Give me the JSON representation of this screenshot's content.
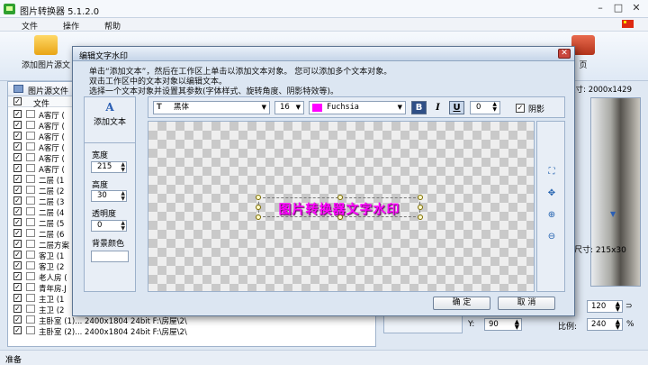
{
  "app": {
    "title": "图片转换器 5.1.2.0",
    "menu": [
      "文件",
      "操作",
      "帮助"
    ],
    "toolbar": {
      "add_image_source": "添加图片源文",
      "page": "页"
    },
    "source_panel_title": "图片源文件",
    "column_file": "文件",
    "files": [
      "A客厅 (",
      "A客厅 (",
      "A客厅 (",
      "A客厅 (",
      "A客厅 (",
      "A客厅 (",
      "二层 (1",
      "二层 (2",
      "二层 (3",
      "二层 (4",
      "二层 (5",
      "二层 (6",
      "二层方案",
      "客卫 (1",
      "客卫 (2",
      "老人房 (",
      "青年房.J",
      "主卫 (1",
      "主卫 (2",
      "主卧室 (1)...    2400x1804  24bit  F:\\房屋\\2\\",
      "主卧室 (2)...    2400x1804  24bit  F:\\房屋\\2\\"
    ],
    "image_size": "尺寸: 2000x1429",
    "watermark_size": "尺寸: 215x30",
    "value_120": "120",
    "y_label": "Y:",
    "y_value": "90",
    "scale_label": "比例:",
    "scale_value": "240",
    "percent": "%",
    "status": "准备"
  },
  "dialog": {
    "title": "编辑文字水印",
    "hints": [
      "单击“添加文本”，然后在工作区上单击以添加文本对象。 您可以添加多个文本对象。",
      "双击工作区中的文本对象以编辑文本。",
      "选择一个文本对象并设置其参数(字体样式、旋转角度、阴影特效等)。"
    ],
    "add_text": "添加文本",
    "width_label": "宽度",
    "width_value": "215",
    "height_label": "高度",
    "height_value": "30",
    "opacity_label": "透明度",
    "opacity_value": "0",
    "bg_color_label": "背景颜色",
    "font_name": "黑体",
    "font_size": "16",
    "color_name": "Fuchsia",
    "color_hex": "#ff00ff",
    "bold": "B",
    "italic": "I",
    "underline": "U",
    "rotation": "0",
    "shadow_label": "阴影",
    "watermark_text": "图片转换器文字水印",
    "ok": "确 定",
    "cancel": "取 消"
  }
}
